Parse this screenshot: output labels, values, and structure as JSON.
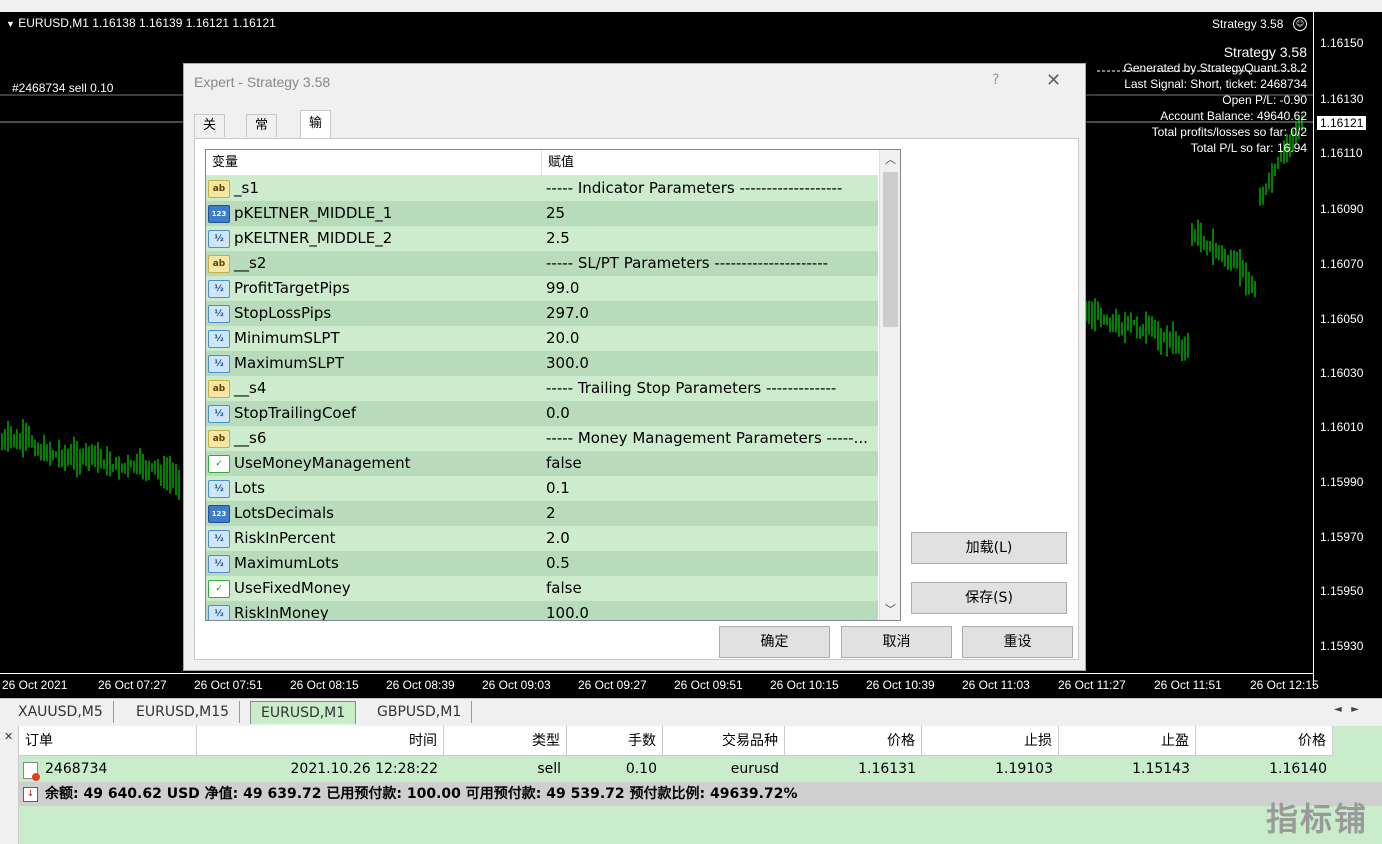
{
  "chart": {
    "title": "EURUSD,M1  1.16138 1.16139 1.16121 1.16121",
    "order_label": "#2468734 sell 0.10",
    "colors": {
      "background": "#000000",
      "candles": "#00ff00",
      "text": "#ffffff"
    },
    "overlay_top": "Strategy 3.58",
    "overlay": [
      "Strategy 3.58",
      "Generated by StrategyQuant 3.8.2",
      "Last Signal: Short, ticket: 2468734",
      "Open P/L: -0.90",
      "Account Balance: 49640.62",
      "Total profits/losses so far: 0/2",
      "Total P/L so far: 16.94"
    ],
    "price_levels": [
      "1.16150",
      "1.16130",
      "1.16121",
      "1.16110",
      "1.16090",
      "1.16070",
      "1.16050",
      "1.16030",
      "1.16010",
      "1.15990",
      "1.15970",
      "1.15950",
      "1.15930"
    ],
    "current_price": "1.16121",
    "time_labels": [
      "26 Oct 2021",
      "26 Oct 07:27",
      "26 Oct 07:51",
      "26 Oct 08:15",
      "26 Oct 08:39",
      "26 Oct 09:03",
      "26 Oct 09:27",
      "26 Oct 09:51",
      "26 Oct 10:15",
      "26 Oct 10:39",
      "26 Oct 11:03",
      "26 Oct 11:27",
      "26 Oct 11:51",
      "26 Oct 12:15"
    ]
  },
  "dialog": {
    "title": "Expert - Strategy 3.58",
    "help": "?",
    "close": "✕",
    "tabs": [
      "关于",
      "常用",
      "输入参数"
    ],
    "active_tab": "输入参数",
    "columns": [
      "变量",
      "赋值"
    ],
    "rows": [
      {
        "icon": "ab",
        "name": "_s1",
        "value": "-----  Indicator Parameters  -------------------"
      },
      {
        "icon": "123",
        "name": "pKELTNER_MIDDLE_1",
        "value": "25"
      },
      {
        "icon": "v2",
        "name": "pKELTNER_MIDDLE_2",
        "value": "2.5"
      },
      {
        "icon": "ab",
        "name": "__s2",
        "value": "-----  SL/PT Parameters  ---------------------"
      },
      {
        "icon": "v2",
        "name": "ProfitTargetPips",
        "value": "99.0"
      },
      {
        "icon": "v2",
        "name": "StopLossPips",
        "value": "297.0"
      },
      {
        "icon": "v2",
        "name": "MinimumSLPT",
        "value": "20.0"
      },
      {
        "icon": "v2",
        "name": "MaximumSLPT",
        "value": "300.0"
      },
      {
        "icon": "ab",
        "name": "__s4",
        "value": "-----  Trailing Stop Parameters  -------------"
      },
      {
        "icon": "v2",
        "name": "StopTrailingCoef",
        "value": "0.0"
      },
      {
        "icon": "ab",
        "name": "__s6",
        "value": "-----  Money Management Parameters  -----..."
      },
      {
        "icon": "bool",
        "name": "UseMoneyManagement",
        "value": "false"
      },
      {
        "icon": "v2",
        "name": "Lots",
        "value": "0.1"
      },
      {
        "icon": "123",
        "name": "LotsDecimals",
        "value": "2"
      },
      {
        "icon": "v2",
        "name": "RiskInPercent",
        "value": "2.0"
      },
      {
        "icon": "v2",
        "name": "MaximumLots",
        "value": "0.5"
      },
      {
        "icon": "bool",
        "name": "UseFixedMoney",
        "value": "false"
      },
      {
        "icon": "v2",
        "name": "RiskInMoney",
        "value": "100.0"
      }
    ],
    "icon_glyphs": {
      "ab": "ab",
      "123": "123",
      "v2": "½",
      "bool": "✓"
    },
    "buttons": {
      "load": "加载(L)",
      "save": "保存(S)",
      "ok": "确定",
      "cancel": "取消",
      "reset": "重设"
    }
  },
  "symbol_tabs": [
    "XAUUSD,M5",
    "EURUSD,M15",
    "EURUSD,M1",
    "GBPUSD,M1"
  ],
  "active_symbol_tab": "EURUSD,M1",
  "terminal": {
    "headers": [
      "订单",
      "时间",
      "类型",
      "手数",
      "交易品种",
      "价格",
      "止损",
      "止盈",
      "价格"
    ],
    "order": {
      "id": "2468734",
      "time": "2021.10.26 12:28:22",
      "type": "sell",
      "lots": "0.10",
      "symbol": "eurusd",
      "price": "1.16131",
      "sl": "1.19103",
      "tp": "1.15143",
      "current": "1.16140"
    },
    "balance": "余额: 49 640.62 USD  净值: 49 639.72  已用预付款: 100.00  可用预付款: 49 539.72  预付款比例: 49639.72%"
  },
  "watermark": "指标铺"
}
